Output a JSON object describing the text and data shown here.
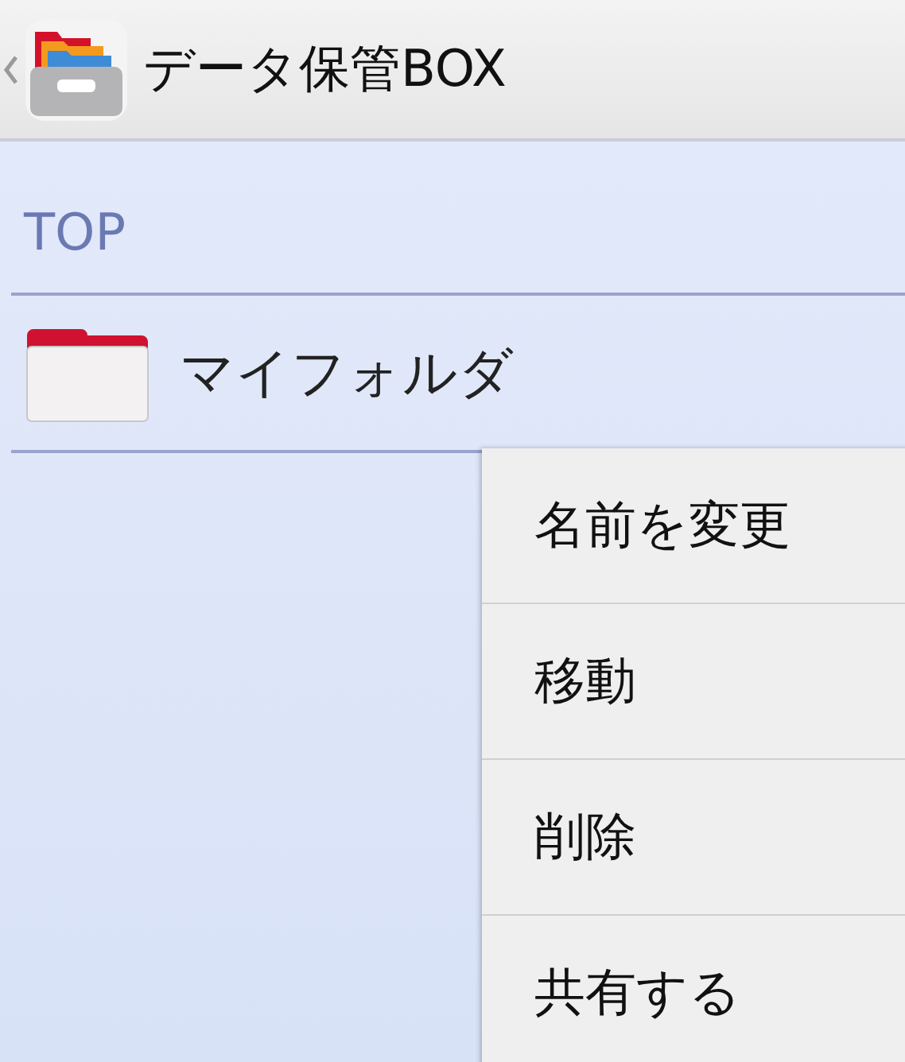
{
  "app_bar": {
    "title": "データ保管BOX"
  },
  "breadcrumb": "TOP",
  "items": [
    {
      "name": "マイフォルダ",
      "kind": "folder"
    }
  ],
  "context_menu": [
    "名前を変更",
    "移動",
    "削除",
    "共有する"
  ]
}
